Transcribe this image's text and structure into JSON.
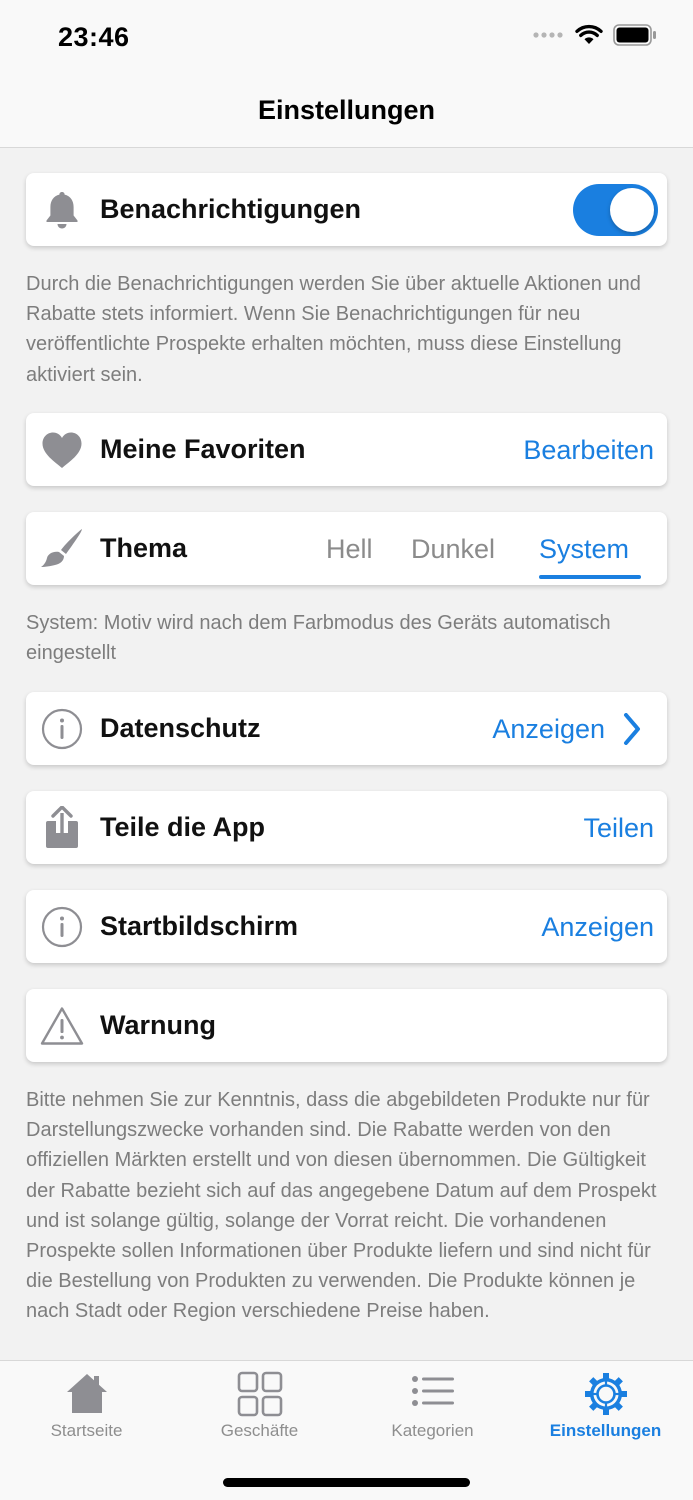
{
  "status_bar": {
    "time": "23:46"
  },
  "header": {
    "title": "Einstellungen"
  },
  "notifications": {
    "label": "Benachrichtigungen",
    "enabled": true,
    "description": "Durch die Benachrichtigungen werden Sie über aktuelle Aktionen und Rabatte stets informiert. Wenn Sie Benachrichti­gungen für neu veröffentlichte Prospekte erhalten möchten, muss diese Einstellung aktiviert sein."
  },
  "favorites": {
    "label": "Meine Favoriten",
    "action": "Bearbeiten"
  },
  "theme": {
    "label": "Thema",
    "options": [
      "Hell",
      "Dunkel",
      "System"
    ],
    "selected": "System",
    "description": "System: Motiv wird nach dem Farbmodus des Geräts automatisch eingestellt"
  },
  "privacy": {
    "label": "Datenschutz",
    "action": "Anzeigen"
  },
  "share": {
    "label": "Teile die App",
    "action": "Teilen"
  },
  "startscreen": {
    "label": "Startbildschirm",
    "action": "Anzeigen"
  },
  "warning": {
    "label": "Warnung",
    "description": "Bitte nehmen Sie zur Kenntnis, dass die abgebildeten Produkte nur für Darstellungszwecke vorhanden sind. Die Rabatte werden von den offiziellen Märkten erstellt und von diesen übernommen. Die Gültigkeit der Rabatte bezieht sich auf das angegebene Datum auf dem Prospekt und ist solange gültig, solange der Vorrat reicht. Die vorhandenen Prospekte sollen Informationen über Produkte liefern und sind nicht für die Bestellung von Produkten zu verwenden. Die Produkte können je nach Stadt oder Region verschiedene Preise haben."
  },
  "tab_bar": {
    "items": [
      {
        "label": "Startseite",
        "icon": "house-icon"
      },
      {
        "label": "Geschäfte",
        "icon": "grid-icon"
      },
      {
        "label": "Kategorien",
        "icon": "list-icon"
      },
      {
        "label": "Einstellungen",
        "icon": "gear-icon"
      }
    ],
    "active": "Einstellungen"
  },
  "colors": {
    "accent": "#1a7fe0",
    "icon_gray": "#8e8e93",
    "secondary_text": "#7d7d7d",
    "background": "#f2f2f2"
  }
}
